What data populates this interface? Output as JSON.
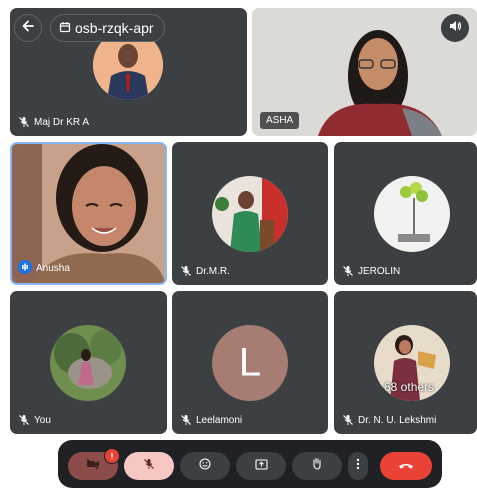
{
  "header": {
    "meeting_code": "osb-rzqk-apr"
  },
  "participants": [
    {
      "name": "Maj Dr KR A",
      "muted": true
    },
    {
      "name": "ASHA",
      "muted": false
    },
    {
      "name": "Anusha",
      "muted": false,
      "speaking": true
    },
    {
      "name": "Dr.M.R.",
      "muted": true
    },
    {
      "name": "JEROLIN",
      "muted": true
    },
    {
      "name": "You",
      "muted": true
    },
    {
      "name": "Leelamoni",
      "muted": true,
      "initial": "L"
    },
    {
      "name": "Dr. N. U. Lekshmi",
      "muted": true
    }
  ],
  "others_count_label": "68 others",
  "controls": {
    "camera_badge": "!"
  },
  "colors": {
    "tile": "#3c4043",
    "control_bar": "#202124",
    "end_call": "#ea4335",
    "active_border": "#8ab4f8",
    "mic_active": "#f6c7c3",
    "camera_off": "#8c4c4a"
  }
}
